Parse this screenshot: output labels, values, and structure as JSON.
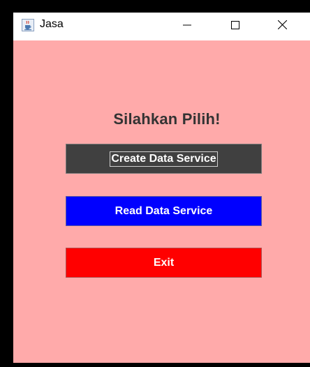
{
  "window": {
    "title": "Jasa",
    "app_icon": "java-cup-icon",
    "controls": {
      "minimize_icon": "minimize-icon",
      "maximize_icon": "maximize-icon",
      "close_icon": "close-icon"
    }
  },
  "main": {
    "heading": "Silahkan Pilih!",
    "buttons": {
      "create_label": "Create Data Service",
      "read_label": "Read Data Service",
      "exit_label": "Exit"
    }
  },
  "colors": {
    "content_background": "#ffaaaa",
    "create_button": "#404040",
    "read_button": "#0000ff",
    "exit_button": "#ff0000",
    "heading_text": "#333333"
  }
}
